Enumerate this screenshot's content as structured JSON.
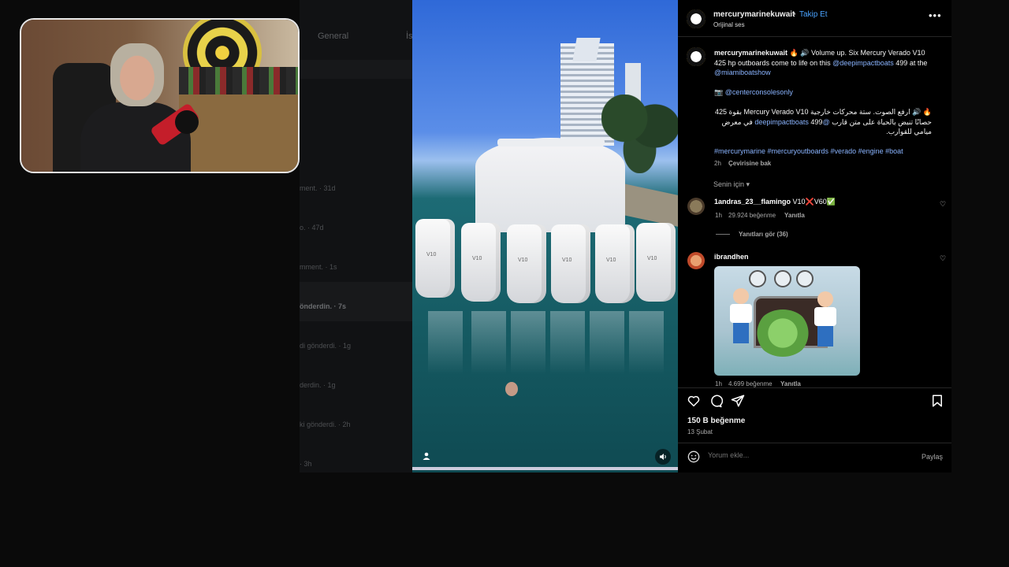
{
  "background": {
    "tabs": [
      "General",
      "İs"
    ],
    "rows": [
      {
        "text": "ment. · 31d"
      },
      {
        "text": "o. · 47d"
      },
      {
        "text": "mment. · 1s"
      },
      {
        "text": "önderdin. · 7s",
        "bold": true
      },
      {
        "text": "di gönderdi. · 1g"
      },
      {
        "text": "derdin. · 1g"
      },
      {
        "text": "ki gönderdi. · 2h"
      },
      {
        "text": "· 3h"
      }
    ]
  },
  "post": {
    "header": {
      "username": "mercurymarinekuwait",
      "separator": "•",
      "follow_label": "Takip Et",
      "audio": "Orijinal ses",
      "more": "•••"
    },
    "caption": {
      "username": "mercurymarinekuwait",
      "text1": " 🔥 🔊 Volume up. Six Mercury Verado V10 425 hp outboards come to life on this ",
      "mention1": "@deepimpactboats",
      "text2": " 499 at the ",
      "mention2": "@miamiboatshow",
      "credit_icon": "📷",
      "mention3": "@centerconsolesonly",
      "arabic_pre": "🔥 🔊 ارفع الصوت. ستة محركات خارجية Mercury Verado V10 بقوة 425 حصانًا تنبض بالحياة على متن قارب ",
      "arabic_mention": "@deepimpactboats",
      "arabic_post": " 499 في معرض ميامي للقوارب.",
      "hashtags": "#mercurymarine #mercuryoutboards #verado #engine #boat",
      "time": "2h",
      "translate": "Çevirisine bak"
    },
    "sort_label": "Senin için ▾",
    "comments": [
      {
        "username": "1andras_23__flamingo",
        "text": " V10❌V60✅",
        "time": "1h",
        "likes": "29.924 beğenme",
        "reply": "Yanıtla",
        "view_replies": "Yanıtları gör (36)"
      },
      {
        "username": "ibrandhen",
        "time": "1h",
        "likes": "4.699 beğenme",
        "reply": "Yanıtla"
      }
    ],
    "likes_count": "150 B beğenme",
    "date": "13 Şubat",
    "comment_placeholder": "Yorum ekle...",
    "share_label": "Paylaş"
  },
  "video": {
    "engine_label": "V10"
  },
  "colors": {
    "link": "#4aa3ff",
    "mention": "#8ab4ff",
    "panel_bg": "#000000"
  }
}
